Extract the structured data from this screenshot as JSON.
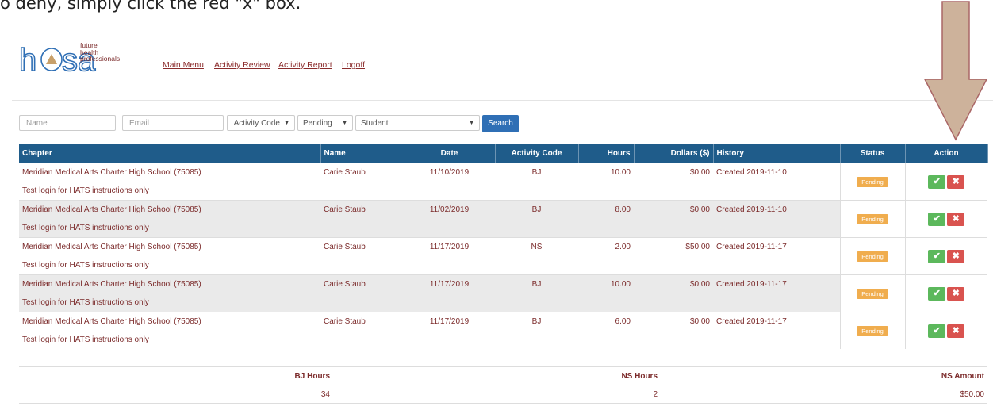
{
  "caption": "o deny, simply click the red \"x\" box.",
  "logo": {
    "brand": "hosa",
    "line1": "future",
    "line2": "health",
    "line3": "professionals"
  },
  "nav": [
    "Main Menu",
    "Activity Review",
    "Activity Report",
    "Logoff"
  ],
  "filters": {
    "name_placeholder": "Name",
    "email_placeholder": "Email",
    "activity_code": "Activity Code",
    "status": "Pending",
    "student": "Student",
    "search_label": "Search"
  },
  "table": {
    "headers": [
      "Chapter",
      "Name",
      "Date",
      "Activity Code",
      "Hours",
      "Dollars ($)",
      "History",
      "Status",
      "Action"
    ],
    "rows": [
      {
        "chapter": "Meridian Medical Arts Charter High School (75085)",
        "name": "Carie Staub",
        "date": "11/10/2019",
        "code": "BJ",
        "hours": "10.00",
        "dollars": "$0.00",
        "history": "Created 2019-11-10",
        "note": "Test login for HATS instructions only",
        "status": "Pending"
      },
      {
        "chapter": "Meridian Medical Arts Charter High School (75085)",
        "name": "Carie Staub",
        "date": "11/02/2019",
        "code": "BJ",
        "hours": "8.00",
        "dollars": "$0.00",
        "history": "Created 2019-11-10",
        "note": "Test login for HATS instructions only",
        "status": "Pending"
      },
      {
        "chapter": "Meridian Medical Arts Charter High School (75085)",
        "name": "Carie Staub",
        "date": "11/17/2019",
        "code": "NS",
        "hours": "2.00",
        "dollars": "$50.00",
        "history": "Created 2019-11-17",
        "note": "Test login for HATS instructions only",
        "status": "Pending"
      },
      {
        "chapter": "Meridian Medical Arts Charter High School (75085)",
        "name": "Carie Staub",
        "date": "11/17/2019",
        "code": "BJ",
        "hours": "10.00",
        "dollars": "$0.00",
        "history": "Created 2019-11-17",
        "note": "Test login for HATS instructions only",
        "status": "Pending"
      },
      {
        "chapter": "Meridian Medical Arts Charter High School (75085)",
        "name": "Carie Staub",
        "date": "11/17/2019",
        "code": "BJ",
        "hours": "6.00",
        "dollars": "$0.00",
        "history": "Created 2019-11-17",
        "note": "Test login for HATS instructions only",
        "status": "Pending"
      }
    ]
  },
  "summary": {
    "headers": [
      "BJ Hours",
      "NS Hours",
      "NS Amount"
    ],
    "values": [
      "34",
      "2",
      "$50.00"
    ]
  },
  "colors": {
    "header_bg": "#1f5c8a",
    "link": "#8b2c2c",
    "pending": "#f0ad4e",
    "approve": "#5cb85c",
    "deny": "#d9534f",
    "arrow": "#c8a98e"
  },
  "icons": {
    "approve": "check-icon",
    "deny": "close-icon",
    "caret": "caret-down-icon"
  }
}
